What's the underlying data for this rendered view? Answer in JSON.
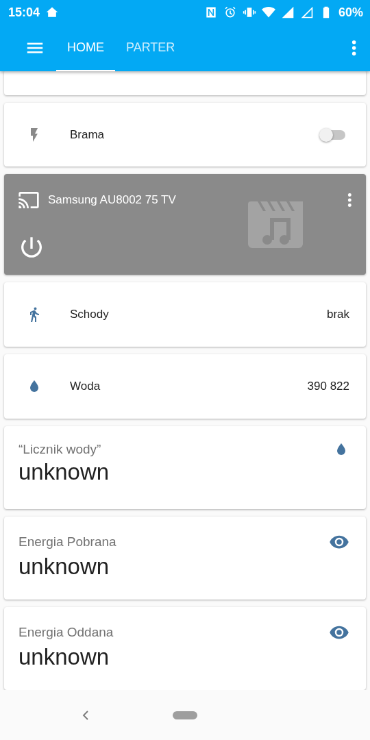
{
  "status_bar": {
    "time": "15:04",
    "battery": "60%"
  },
  "tabs": [
    {
      "label": "HOME",
      "selected": true
    },
    {
      "label": "PARTER",
      "selected": false
    }
  ],
  "cards": [
    {
      "kind": "toggle",
      "name": "Brama",
      "on": false
    },
    {
      "kind": "media",
      "name": "Samsung AU8002 75 TV"
    },
    {
      "kind": "sensor",
      "name": "Schody",
      "value": "brak"
    },
    {
      "kind": "sensor",
      "name": "Woda",
      "value": "390 822"
    },
    {
      "kind": "big",
      "name": "“Licznik wody”",
      "value": "unknown"
    },
    {
      "kind": "big",
      "name": "Energia Pobrana",
      "value": "unknown"
    },
    {
      "kind": "big",
      "name": "Energia Oddana",
      "value": "unknown"
    }
  ]
}
